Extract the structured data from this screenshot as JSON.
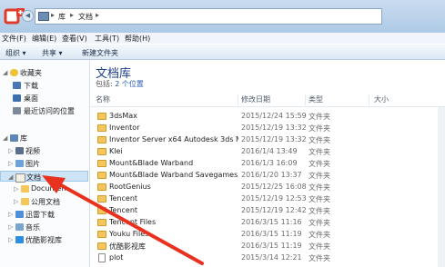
{
  "address": {
    "segments": [
      "库",
      "文档"
    ]
  },
  "menu": [
    "文件(F)",
    "编辑(E)",
    "查看(V)",
    "工具(T)",
    "帮助(H)"
  ],
  "toolbar": {
    "organize": "组织 ▾",
    "share": "共享 ▾",
    "new_folder": "新建文件夹"
  },
  "nav": {
    "favorites": "收藏夹",
    "downloads": "下载",
    "desktop": "桌面",
    "recent": "最近访问的位置",
    "libraries": "库",
    "videos": "视频",
    "pictures": "图片",
    "documents": "文档",
    "my_documents": "Documen",
    "public_documents": "公用文档",
    "thunder": "迅雷下载",
    "music": "音乐",
    "youku": "优酷影视库"
  },
  "main": {
    "title": "文档库",
    "subtitle_prefix": "包括:",
    "subtitle_link": "2 个位置",
    "columns": {
      "name": "名称",
      "modified": "修改日期",
      "type": "类型",
      "size": "大小"
    },
    "rows": [
      {
        "name": "3dsMax",
        "date": "2015/12/24 15:59",
        "type": "文件夹",
        "kind": "folder"
      },
      {
        "name": "Inventor",
        "date": "2015/12/19 13:32",
        "type": "文件夹",
        "kind": "folder"
      },
      {
        "name": "Inventor Server x64 Autodesk 3ds M...",
        "date": "2015/12/19 13:32",
        "type": "文件夹",
        "kind": "folder"
      },
      {
        "name": "Klei",
        "date": "2016/1/4 13:49",
        "type": "文件夹",
        "kind": "folder"
      },
      {
        "name": "Mount&Blade Warband",
        "date": "2016/1/3 16:09",
        "type": "文件夹",
        "kind": "folder"
      },
      {
        "name": "Mount&Blade Warband Savegames",
        "date": "2016/1/20 13:37",
        "type": "文件夹",
        "kind": "folder"
      },
      {
        "name": "RootGenius",
        "date": "2015/12/25 16:08",
        "type": "文件夹",
        "kind": "folder"
      },
      {
        "name": "Tencent",
        "date": "2015/12/19 12:53",
        "type": "文件夹",
        "kind": "folder"
      },
      {
        "name": "Tencent",
        "date": "2015/12/19 12:42",
        "type": "文件夹",
        "kind": "folder"
      },
      {
        "name": "Tencent Files",
        "date": "2016/3/15 11:16",
        "type": "文件夹",
        "kind": "folder"
      },
      {
        "name": "Youku Files",
        "date": "2016/3/15 11:19",
        "type": "文件夹",
        "kind": "folder"
      },
      {
        "name": "优酷影视库",
        "date": "2016/3/15 11:19",
        "type": "文件夹",
        "kind": "folder"
      },
      {
        "name": "plot",
        "date": "2015/3/14 12:21",
        "type": "文件夹",
        "kind": "file"
      }
    ]
  },
  "colors": {
    "arrow": "#e8321f",
    "title": "#1e3f8a",
    "selected": "#cde4f7"
  }
}
